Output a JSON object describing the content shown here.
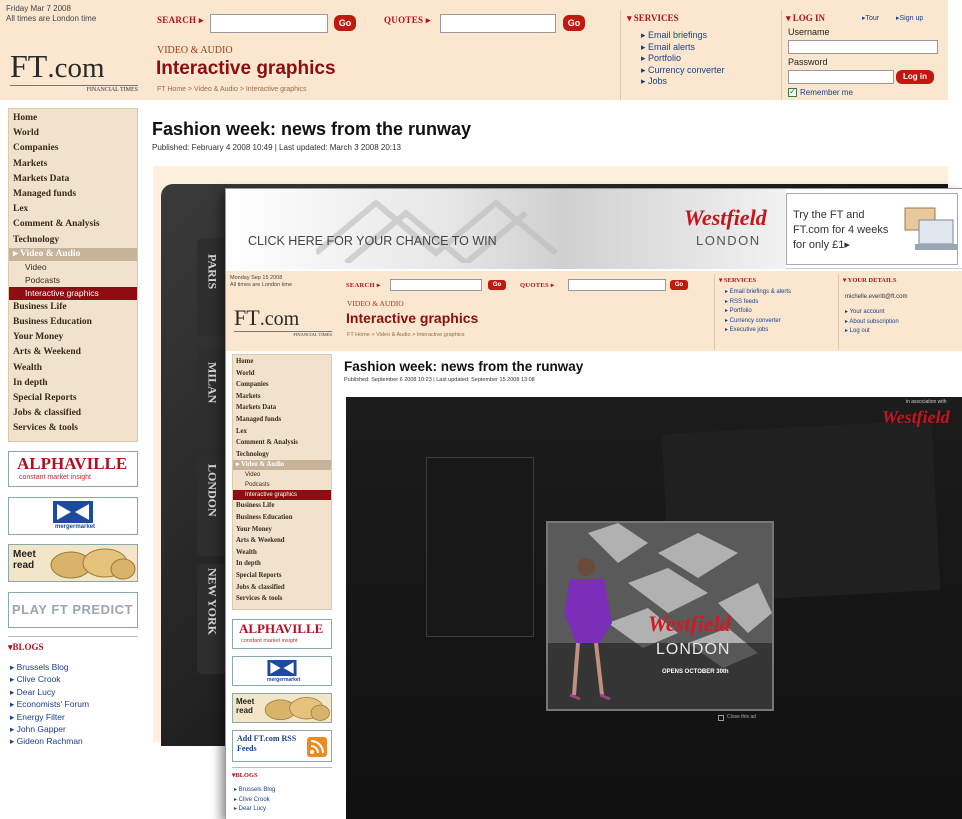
{
  "back": {
    "date": "Friday Mar 7 2008",
    "tz": "All times are London time",
    "search_label": "SEARCH ▸",
    "go": "Go",
    "quotes_label": "QUOTES ▸",
    "logo_ft": "FT",
    "logo_com": ".com",
    "logo_sub": "FINANCIAL TIMES",
    "section_sub": "VIDEO & AUDIO",
    "section_title": "Interactive graphics",
    "breadcrumb": "FT Home  >  Video & Audio  >  Interactive graphics",
    "services_title": "▾ SERVICES",
    "services": [
      "▸ Email briefings",
      "▸ Email alerts",
      "▸ Portfolio",
      "▸ Currency converter",
      "▸ Jobs"
    ],
    "login_title": "▾ LOG IN",
    "login_tour": "▸Tour",
    "login_signup": "▸Sign up",
    "username": "Username",
    "password": "Password",
    "login_btn": "Log in",
    "remember": "Remember me",
    "nav": [
      "Home",
      "World",
      "Companies",
      "Markets",
      "Markets Data",
      "Managed funds",
      "Lex",
      "Comment & Analysis",
      "Technology"
    ],
    "nav_active": "▸ Video & Audio",
    "nav_sub": [
      "Video",
      "Podcasts"
    ],
    "nav_sub_selected": "Interactive graphics",
    "nav_after": [
      "Business Life",
      "Business Education",
      "Your Money",
      "Arts & Weekend",
      "Wealth",
      "In depth",
      "Special Reports",
      "Jobs & classified",
      "Services & tools"
    ],
    "promo_alphaville": "ALPHAVILLE",
    "promo_alphaville_sub": "constant market insight",
    "promo_merger": "mergermarket",
    "promo_meet": "Meet read",
    "promo_predict": "PLAY FT PREDICT",
    "blogs_title": "▾BLOGS",
    "blogs": [
      "▸ Brussels Blog",
      "▸ Clive Crook",
      "▸ Dear Lucy",
      "▸ Economists' Forum",
      "▸ Energy Filter",
      "▸ John Gapper",
      "▸ Gideon Rachman"
    ],
    "page_title": "Fashion week: news from the runway",
    "published": "Published: February 4 2008 10:49 | Last updated: March 3 2008 20:13",
    "tabs": [
      "PARIS",
      "MILAN",
      "LONDON",
      "NEW YORK"
    ]
  },
  "front": {
    "banner_text": "CLICK HERE FOR YOUR CHANCE TO WIN",
    "banner_brand": "Westfield",
    "banner_city": "LONDON",
    "banner_offer": "Try the FT and FT.com for 4 weeks for only £1▸",
    "date": "Monday Sep 15 2008",
    "tz": "All times are London time",
    "search_label": "SEARCH ▸",
    "go": "Go",
    "quotes_label": "QUOTES ▸",
    "logo_ft": "FT",
    "logo_com": ".com",
    "logo_sub": "FINANCIAL TIMES",
    "section_sub": "VIDEO & AUDIO",
    "section_title": "Interactive graphics",
    "breadcrumb": "FT Home > Video & Audio > Interactive graphics",
    "services_title": "▾ SERVICES",
    "services": [
      "▸ Email briefings & alerts",
      "▸ RSS feeds",
      "▸ Portfolio",
      "▸ Currency converter",
      "▸ Executive jobs"
    ],
    "details_title": "▾ YOUR DETAILS",
    "email": "michelle.everitt@ft.com",
    "details": [
      "▸ Your account",
      "▸ About subscription",
      "▸ Log out"
    ],
    "nav": [
      "Home",
      "World",
      "Companies",
      "Markets",
      "Markets Data",
      "Managed funds",
      "Lex",
      "Comment & Analysis",
      "Technology"
    ],
    "nav_active": "▸ Video & Audio",
    "nav_sub": [
      "Video",
      "Podcasts"
    ],
    "nav_sub_selected": "Interactive graphics",
    "nav_after": [
      "Business Life",
      "Business Education",
      "Your Money",
      "Arts & Weekend",
      "Wealth",
      "In depth",
      "Special Reports",
      "Jobs & classified",
      "Services & tools"
    ],
    "promo_alphaville": "ALPHAVILLE",
    "promo_alphaville_sub": "constant market insight",
    "promo_merger": "mergermarket",
    "promo_meet": "Meet read",
    "rss": "Add FT.com RSS Feeds",
    "blogs_title": "▾BLOGS",
    "blogs": [
      "▸ Brussels Blog",
      "▸ Clive Crook",
      "▸ Dear Lucy"
    ],
    "page_title": "Fashion week: news from the runway",
    "published": "Published: September 6 2008 10:23 | Last updated: September 15 2008 13:08",
    "assoc": "in association with",
    "assoc_brand": "Westfield",
    "ad_brand": "Westfield",
    "ad_city": "LONDON",
    "ad_opens": "OPENS OCTOBER 30th",
    "close_ad": "Close this ad"
  }
}
